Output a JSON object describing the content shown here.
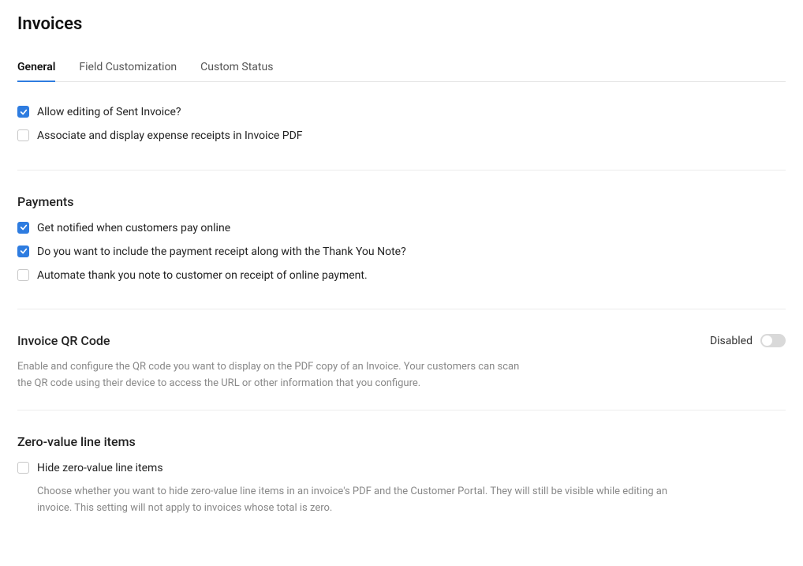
{
  "page": {
    "title": "Invoices"
  },
  "tabs": [
    {
      "label": "General",
      "active": true
    },
    {
      "label": "Field Customization",
      "active": false
    },
    {
      "label": "Custom Status",
      "active": false
    }
  ],
  "top_options": [
    {
      "label": "Allow editing of Sent Invoice?",
      "checked": true
    },
    {
      "label": "Associate and display expense receipts in Invoice PDF",
      "checked": false
    }
  ],
  "payments": {
    "title": "Payments",
    "options": [
      {
        "label": "Get notified when customers pay online",
        "checked": true
      },
      {
        "label": "Do you want to include the payment receipt along with the Thank You Note?",
        "checked": true
      },
      {
        "label": "Automate thank you note to customer on receipt of online payment.",
        "checked": false
      }
    ]
  },
  "qr": {
    "title": "Invoice QR Code",
    "toggle_label": "Disabled",
    "enabled": false,
    "description": "Enable and configure the QR code you want to display on the PDF copy of an Invoice. Your customers can scan the QR code using their device to access the URL or other information that you configure."
  },
  "zero_value": {
    "title": "Zero-value line items",
    "option_label": "Hide zero-value line items",
    "checked": false,
    "description": "Choose whether you want to hide zero-value line items in an invoice's PDF and the Customer Portal. They will still be visible while editing an invoice. This setting will not apply to invoices whose total is zero."
  }
}
